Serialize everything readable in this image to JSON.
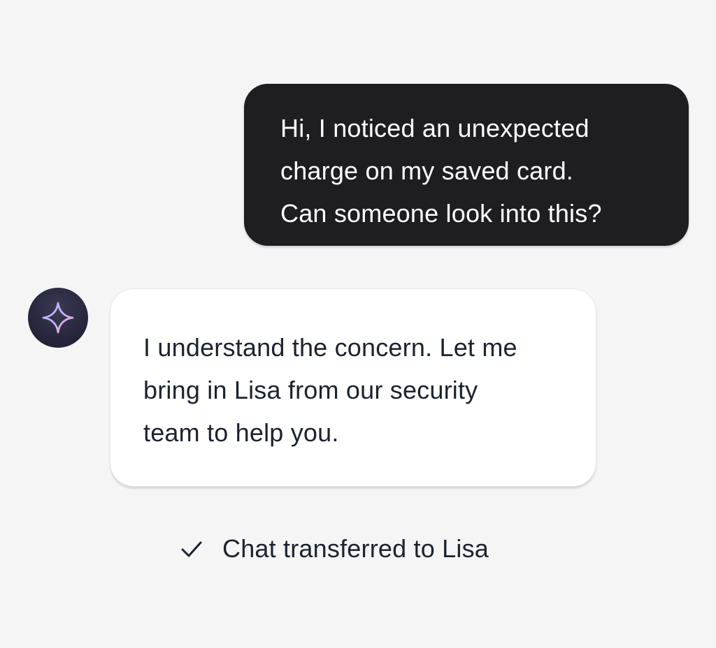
{
  "conversation": {
    "user_message": "Hi, I noticed an unexpected\ncharge on my saved card.\nCan someone look into this?",
    "bot_message": "I understand the concern. Let me\nbring in Lisa from our security\nteam to help you.",
    "bot_avatar_icon": "sparkle-icon",
    "status_icon": "check-icon",
    "status_text": "Chat transferred to Lisa"
  },
  "colors": {
    "background": "#f5f5f5",
    "user_bubble": "#1e1e21",
    "bot_bubble": "#ffffff",
    "text_dark": "#1c2230",
    "text_light": "#ffffff",
    "sparkle_gradient_start": "#9fb8ff",
    "sparkle_gradient_end": "#ff9fb0"
  }
}
